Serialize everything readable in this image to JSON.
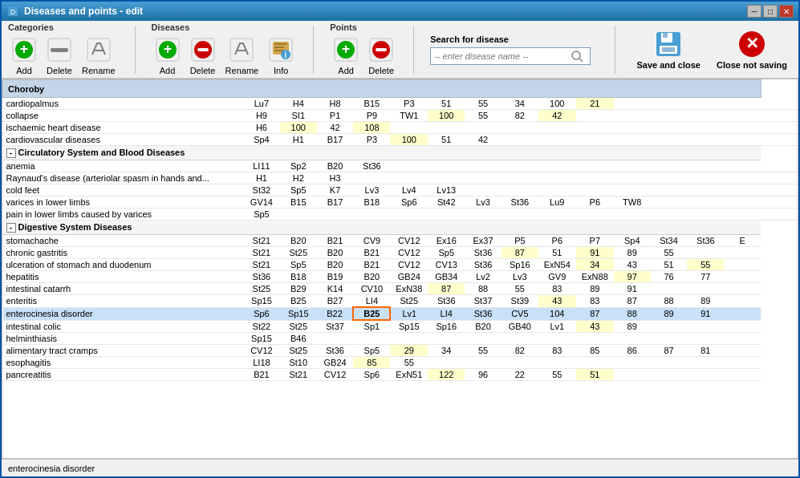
{
  "window": {
    "title": "Diseases and points - edit"
  },
  "toolbar": {
    "categories": {
      "label": "Categories",
      "add": "Add",
      "delete": "Delete",
      "rename": "Rename"
    },
    "diseases": {
      "label": "Diseases",
      "add": "Add",
      "delete": "Delete",
      "rename": "Rename",
      "info": "Info"
    },
    "points": {
      "label": "Points",
      "add": "Add",
      "delete": "Delete"
    },
    "search": {
      "label": "Search for disease",
      "placeholder": "-- enter disease name --"
    },
    "save_and_close": "Save and close",
    "close_not_saving": "Close not saving"
  },
  "table": {
    "header": "Choroby",
    "columns": [
      "",
      "col1",
      "col2",
      "col3",
      "col4",
      "col5",
      "col6",
      "col7",
      "col8",
      "col9",
      "col10",
      "col11",
      "col12",
      "col13",
      "col14"
    ],
    "rows": [
      {
        "type": "data",
        "name": "cardiopalmus",
        "indent": true,
        "cells": [
          "Lu7",
          "H4",
          "H8",
          "B15",
          "P3",
          "51",
          "55",
          "34",
          "100",
          "21",
          "",
          "",
          "",
          "",
          ""
        ],
        "highlight": [
          9
        ]
      },
      {
        "type": "data",
        "name": "collapse",
        "indent": true,
        "cells": [
          "H9",
          "SI1",
          "P1",
          "P9",
          "TW1",
          "100",
          "55",
          "82",
          "42",
          "",
          "",
          "",
          "",
          "",
          ""
        ],
        "highlight": [
          5,
          8
        ]
      },
      {
        "type": "data",
        "name": "ischaemic heart disease",
        "indent": true,
        "cells": [
          "H6",
          "100",
          "42",
          "108",
          "",
          "",
          "",
          "",
          "",
          "",
          "",
          "",
          "",
          "",
          ""
        ],
        "highlight": [
          1,
          3
        ]
      },
      {
        "type": "data",
        "name": "cardiovascular diseases",
        "indent": true,
        "cells": [
          "Sp4",
          "H1",
          "B17",
          "P3",
          "100",
          "51",
          "42",
          "",
          "",
          "",
          "",
          "",
          "",
          "",
          ""
        ],
        "highlight": [
          4
        ]
      },
      {
        "type": "category",
        "name": "Circulatory System and Blood Diseases"
      },
      {
        "type": "data",
        "name": "anemia",
        "indent": true,
        "cells": [
          "LI11",
          "Sp2",
          "B20",
          "St36",
          "",
          "",
          "",
          "",
          "",
          "",
          "",
          "",
          "",
          "",
          ""
        ]
      },
      {
        "type": "data",
        "name": "Raynaud's disease (arteriolar spasm in hands and...",
        "indent": true,
        "cells": [
          "H1",
          "H2",
          "H3",
          "",
          "",
          "",
          "",
          "",
          "",
          "",
          "",
          "",
          "",
          "",
          ""
        ]
      },
      {
        "type": "data",
        "name": "cold feet",
        "indent": true,
        "cells": [
          "St32",
          "Sp5",
          "K7",
          "Lv3",
          "Lv4",
          "Lv13",
          "",
          "",
          "",
          "",
          "",
          "",
          "",
          "",
          ""
        ]
      },
      {
        "type": "data",
        "name": "varices in lower limbs",
        "indent": true,
        "cells": [
          "GV14",
          "B15",
          "B17",
          "B18",
          "Sp6",
          "St42",
          "Lv3",
          "St36",
          "Lu9",
          "P6",
          "TW8",
          "",
          "",
          "",
          ""
        ]
      },
      {
        "type": "data",
        "name": "pain in lower limbs caused by varices",
        "indent": true,
        "cells": [
          "Sp5",
          "",
          "",
          "",
          "",
          "",
          "",
          "",
          "",
          "",
          "",
          "",
          "",
          "",
          ""
        ]
      },
      {
        "type": "category",
        "name": "Digestive System Diseases"
      },
      {
        "type": "data",
        "name": "stomachache",
        "indent": true,
        "cells": [
          "St21",
          "B20",
          "B21",
          "CV9",
          "CV12",
          "Ex16",
          "Ex37",
          "P5",
          "P6",
          "P7",
          "Sp4",
          "St34",
          "St36",
          "E"
        ],
        "highlight": []
      },
      {
        "type": "data",
        "name": "chronic gastritis",
        "indent": true,
        "cells": [
          "St21",
          "St25",
          "B20",
          "B21",
          "CV12",
          "Sp5",
          "St36",
          "87",
          "51",
          "91",
          "89",
          "55",
          "",
          ""
        ],
        "highlight": [
          7,
          9
        ]
      },
      {
        "type": "data",
        "name": "ulceration of stomach and duodenum",
        "indent": true,
        "cells": [
          "St21",
          "Sp5",
          "B20",
          "B21",
          "CV12",
          "CV13",
          "St36",
          "Sp16",
          "ExN54",
          "34",
          "43",
          "51",
          "55",
          ""
        ],
        "highlight": [
          9,
          12
        ]
      },
      {
        "type": "data",
        "name": "hepatitis",
        "indent": true,
        "cells": [
          "St36",
          "B18",
          "B19",
          "B20",
          "GB24",
          "GB34",
          "Lv2",
          "Lv3",
          "GV9",
          "ExN88",
          "97",
          "76",
          "77",
          ""
        ],
        "highlight": [
          10
        ]
      },
      {
        "type": "data",
        "name": "intestinal catarrh",
        "indent": true,
        "cells": [
          "St25",
          "B29",
          "K14",
          "CV10",
          "ExN38",
          "87",
          "88",
          "55",
          "83",
          "89",
          "91",
          "",
          "",
          ""
        ],
        "highlight": [
          5
        ]
      },
      {
        "type": "data",
        "name": "enteritis",
        "indent": true,
        "cells": [
          "Sp15",
          "B25",
          "B27",
          "LI4",
          "St25",
          "St36",
          "St37",
          "St39",
          "43",
          "83",
          "87",
          "88",
          "89",
          ""
        ],
        "highlight": [
          8
        ]
      },
      {
        "type": "data",
        "name": "enterocinesia disorder",
        "indent": true,
        "cells": [
          "Sp6",
          "Sp15",
          "B22",
          "B25",
          "Lv1",
          "LI4",
          "St36",
          "CV5",
          "104",
          "87",
          "88",
          "89",
          "91",
          ""
        ],
        "highlight": [
          3
        ],
        "selected": true,
        "selectedCell": 3
      },
      {
        "type": "data",
        "name": "intestinal colic",
        "indent": true,
        "cells": [
          "St22",
          "St25",
          "St37",
          "Sp1",
          "Sp15",
          "Sp16",
          "B20",
          "GB40",
          "Lv1",
          "43",
          "89",
          "",
          "",
          ""
        ],
        "highlight": [
          9
        ]
      },
      {
        "type": "data",
        "name": "helminthiasis",
        "indent": true,
        "cells": [
          "Sp15",
          "B46",
          "",
          "",
          "",
          "",
          "",
          "",
          "",
          "",
          "",
          "",
          "",
          ""
        ]
      },
      {
        "type": "data",
        "name": "alimentary tract cramps",
        "indent": true,
        "cells": [
          "CV12",
          "St25",
          "St36",
          "Sp5",
          "29",
          "34",
          "55",
          "82",
          "83",
          "85",
          "86",
          "87",
          "81",
          ""
        ],
        "highlight": [
          4
        ]
      },
      {
        "type": "data",
        "name": "esophagitis",
        "indent": true,
        "cells": [
          "LI18",
          "St10",
          "GB24",
          "85",
          "55",
          "",
          "",
          "",
          "",
          "",
          "",
          "",
          "",
          ""
        ],
        "highlight": [
          3
        ]
      },
      {
        "type": "data",
        "name": "pancreatitis",
        "indent": true,
        "cells": [
          "B21",
          "St21",
          "CV12",
          "Sp6",
          "ExN51",
          "122",
          "96",
          "22",
          "55",
          "51",
          "",
          "",
          "",
          ""
        ],
        "highlight": [
          5,
          9
        ]
      }
    ]
  },
  "status_bar": {
    "text": "enterocinesia disorder"
  },
  "colors": {
    "accent": "#1c6ea4",
    "highlight_yellow": "#ffffcc",
    "highlight_selected_bg": "#c8d8f0",
    "cell_selected": "#ff8c00"
  }
}
